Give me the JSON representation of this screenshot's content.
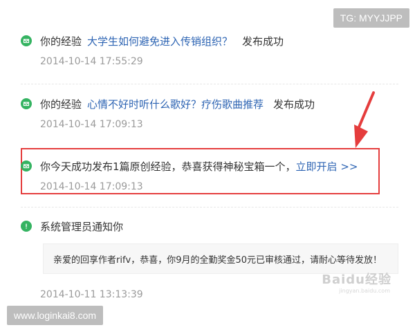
{
  "watermarks": {
    "tg": "TG: MYYJJPP",
    "site": "www.loginkai8.com",
    "baidu_main": "Baidu经验",
    "baidu_sub": "jingyan.baidu.com"
  },
  "feed": [
    {
      "type": "experience",
      "icon": "mail-icon",
      "prefix": "你的经验",
      "link": "大学生如何避免进入传销组织？",
      "suffix": "发布成功",
      "time": "2014-10-14 17:55:29"
    },
    {
      "type": "experience",
      "icon": "mail-icon",
      "prefix": "你的经验",
      "link": "心情不好时听什么歌好？疗伤歌曲推荐",
      "suffix": "发布成功",
      "time": "2014-10-14 17:09:13"
    },
    {
      "type": "reward",
      "icon": "mail-icon",
      "text": "你今天成功发布1篇原创经验，恭喜获得神秘宝箱一个，",
      "link": "立即开启 >>",
      "time": "2014-10-14 17:09:13"
    },
    {
      "type": "admin",
      "icon": "alert-icon",
      "title": "系统管理员通知你",
      "message": "亲爱的回享作者rifv，恭喜，你9月的全勤奖金50元已审核通过，请耐心等待发放！",
      "time": "2014-10-11 13:13:39"
    }
  ],
  "colors": {
    "link": "#2d64b3",
    "green": "#34b361",
    "highlight": "#e53d3d"
  }
}
